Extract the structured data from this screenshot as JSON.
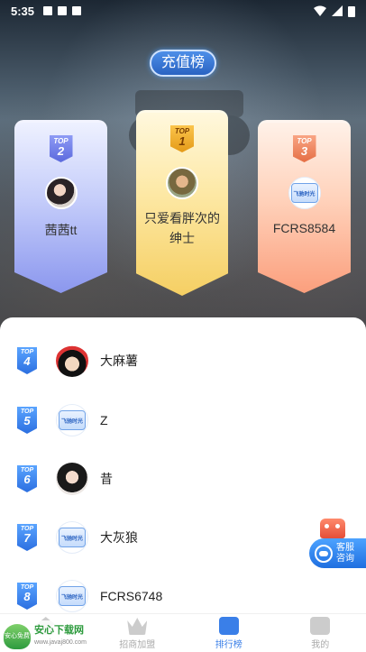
{
  "status_bar": {
    "time": "5:35"
  },
  "header": {
    "recharge_title": "充值榜"
  },
  "podium": [
    {
      "rank_label": "TOP",
      "rank": "2",
      "name": "茜茜tt"
    },
    {
      "rank_label": "TOP",
      "rank": "1",
      "name": "只爱看胖次的绅士"
    },
    {
      "rank_label": "TOP",
      "rank": "3",
      "name": "FCRS8584",
      "avatar_text": "飞驰时光"
    }
  ],
  "list": [
    {
      "rank_label": "TOP",
      "rank": "4",
      "name": "大麻薯"
    },
    {
      "rank_label": "TOP",
      "rank": "5",
      "name": "Z",
      "avatar_text": "飞驰时光"
    },
    {
      "rank_label": "TOP",
      "rank": "6",
      "name": "昔"
    },
    {
      "rank_label": "TOP",
      "rank": "7",
      "name": "大灰狼",
      "avatar_text": "飞驰时光"
    },
    {
      "rank_label": "TOP",
      "rank": "8",
      "name": "FCRS6748",
      "avatar_text": "飞驰时光"
    }
  ],
  "customer_service": {
    "label": "客服咨询"
  },
  "tabbar": {
    "items": [
      {
        "label": ""
      },
      {
        "label": "招商加盟"
      },
      {
        "label": "排行榜"
      },
      {
        "label": "我的"
      }
    ]
  },
  "watermark": {
    "title": "安心下载网",
    "url": "www.javaj800.com",
    "badge": "安心免费"
  }
}
